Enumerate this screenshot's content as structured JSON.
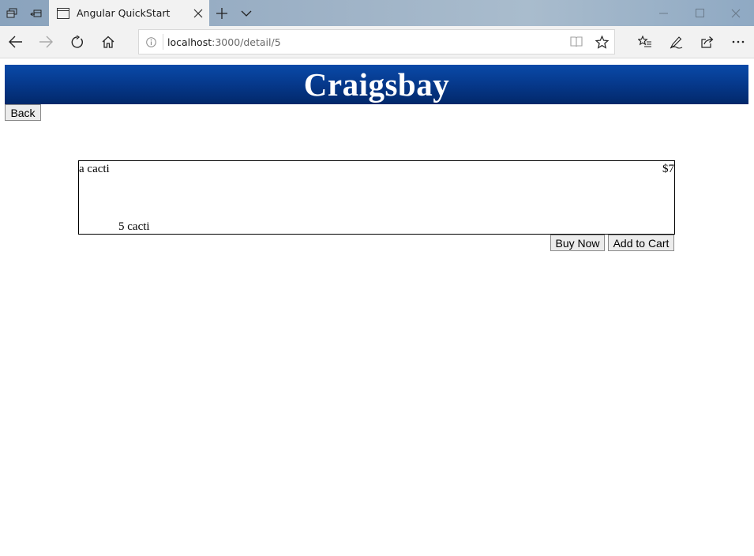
{
  "browser": {
    "tab_title": "Angular QuickStart",
    "url_host": "localhost",
    "url_path": ":3000/detail/5"
  },
  "icons": {
    "tab_manager": "tabs-aside-icon",
    "set_aside": "set-aside-icon",
    "favicon": "page-icon",
    "close_tab": "close-icon",
    "new_tab": "plus-icon",
    "tab_list": "chevron-down-icon",
    "minimize": "minimize-icon",
    "maximize": "maximize-icon",
    "close_window": "close-icon",
    "back": "arrow-left-icon",
    "forward": "arrow-right-icon",
    "refresh": "refresh-icon",
    "home": "home-icon",
    "site_info": "info-icon",
    "reading_view": "book-icon",
    "favorite": "star-icon",
    "favorites_hub": "favorites-list-icon",
    "web_note": "pen-icon",
    "share": "share-icon",
    "more": "more-icon"
  },
  "page": {
    "site_title": "Craigsbay",
    "back_label": "Back",
    "item": {
      "name": "a cacti",
      "price": "$7",
      "description": "5 cacti"
    },
    "buy_now_label": "Buy Now",
    "add_to_cart_label": "Add to Cart"
  },
  "colors": {
    "header_top": "#0a4aa8",
    "header_bottom": "#02286a",
    "chrome_tabbar": "#9fb3c7",
    "chrome_toolbar": "#f2f2f2"
  }
}
